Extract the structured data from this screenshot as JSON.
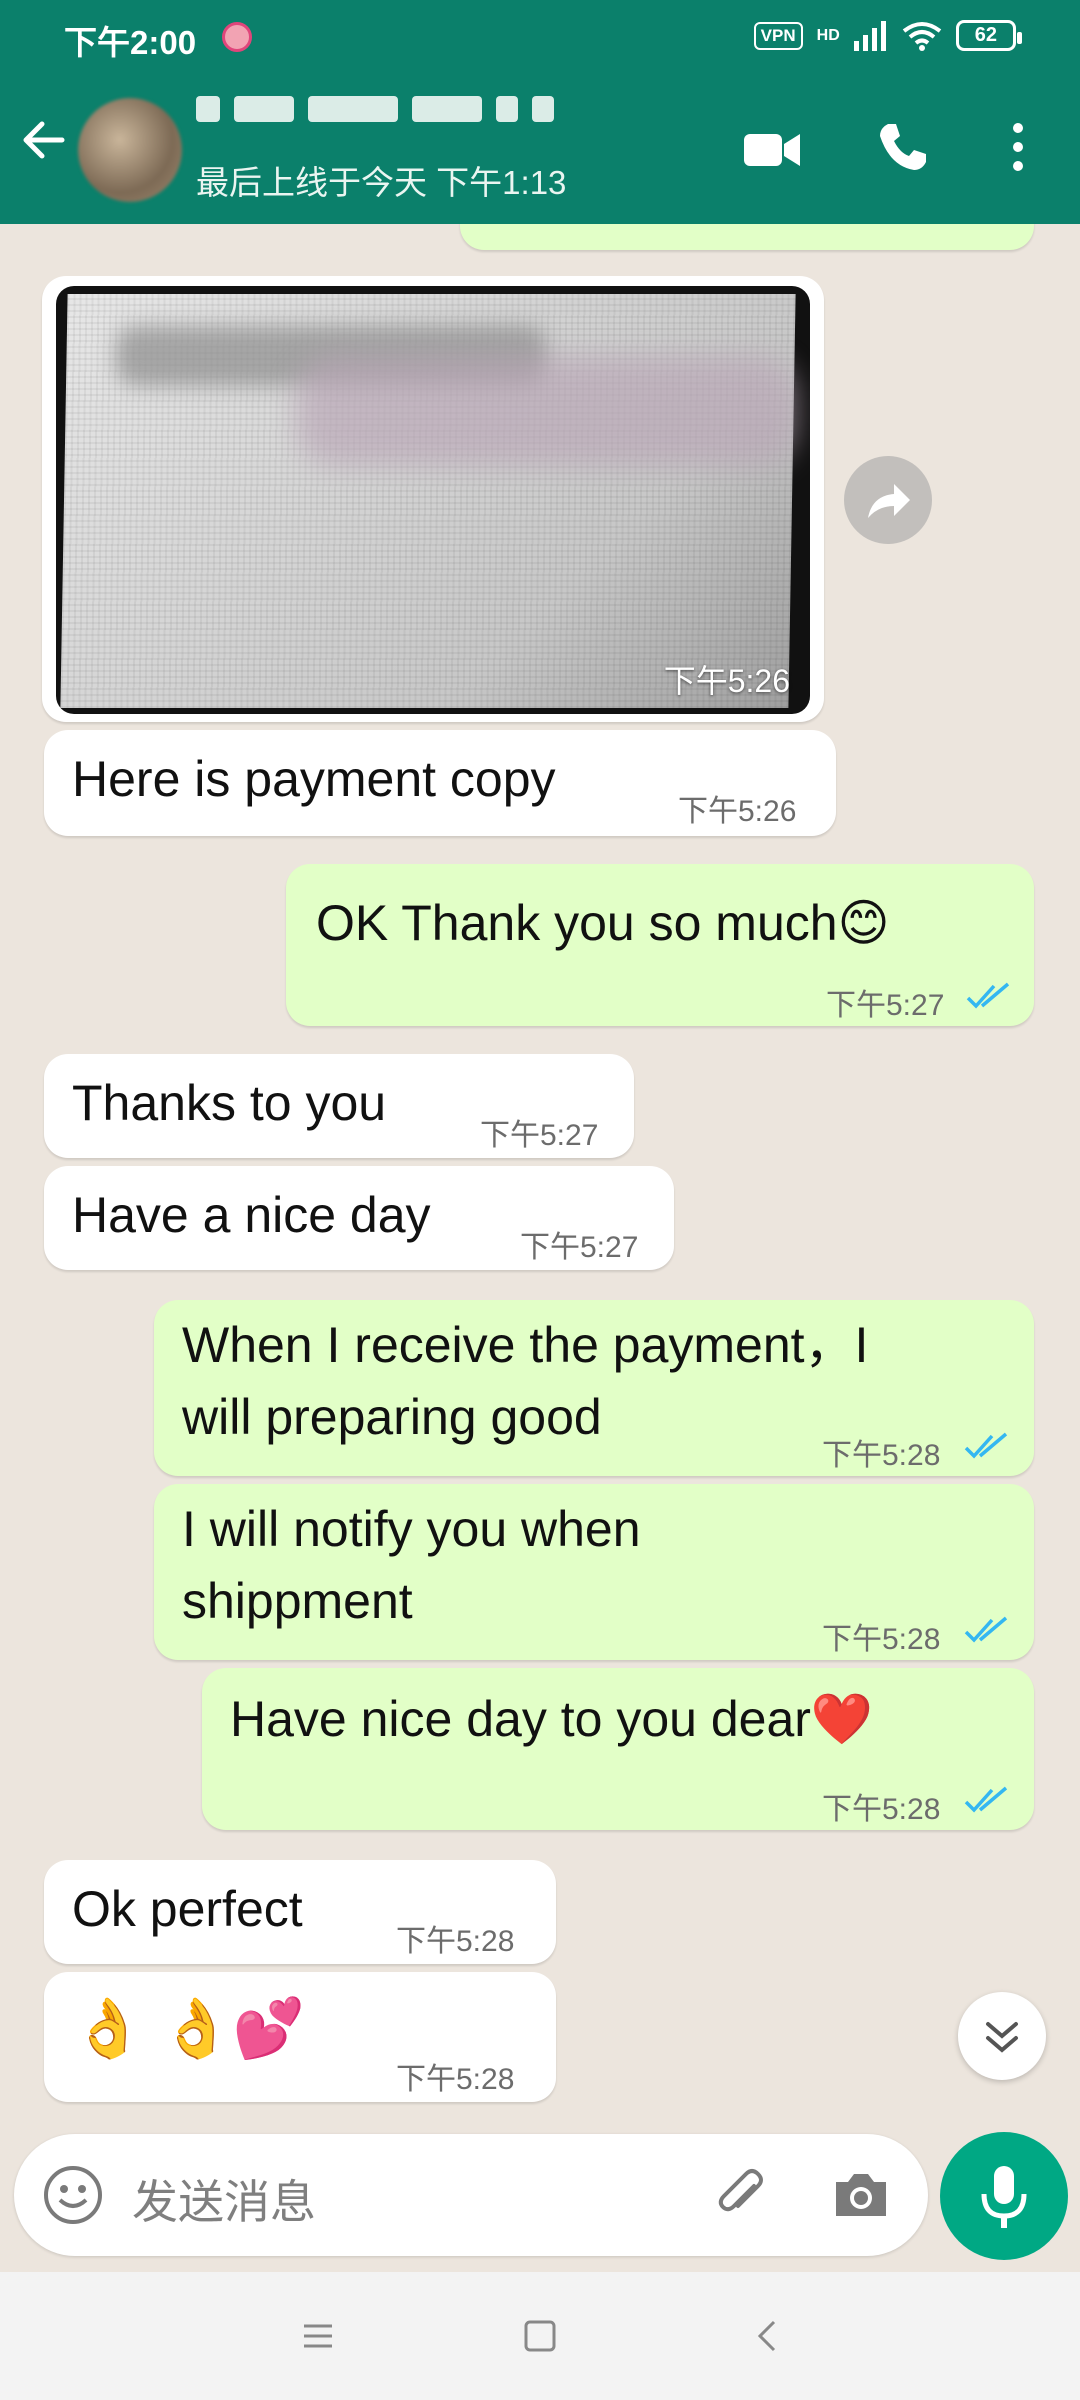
{
  "status_bar": {
    "time": "下午2:00",
    "vpn": "VPN",
    "hd": "HD",
    "battery": "62"
  },
  "header": {
    "last_seen": "最后上线于今天 下午1:13"
  },
  "messages": [
    {
      "id": "m1",
      "type": "image",
      "direction": "incoming",
      "time": "下午5:26"
    },
    {
      "id": "m2",
      "direction": "incoming",
      "text": "Here is payment copy",
      "time": "下午5:26"
    },
    {
      "id": "m3",
      "direction": "outgoing",
      "text": "OK Thank you so much😊",
      "time": "下午5:27"
    },
    {
      "id": "m4",
      "direction": "incoming",
      "text": "Thanks to you",
      "time": "下午5:27"
    },
    {
      "id": "m5",
      "direction": "incoming",
      "text": "Have a nice day",
      "time": "下午5:27"
    },
    {
      "id": "m6",
      "direction": "outgoing",
      "text_line1": "When I receive the payment，I",
      "text_line2": "will preparing good",
      "time": "下午5:28"
    },
    {
      "id": "m7",
      "direction": "outgoing",
      "text_line1": "I will notify you when",
      "text_line2": "shippment",
      "time": "下午5:28"
    },
    {
      "id": "m8",
      "direction": "outgoing",
      "text": "Have  nice day to you dear❤️",
      "time": "下午5:28"
    },
    {
      "id": "m9",
      "direction": "incoming",
      "text": "Ok perfect",
      "time": "下午5:28"
    },
    {
      "id": "m10",
      "direction": "incoming",
      "text": "👌 👌💕",
      "time": "下午5:28"
    }
  ],
  "composer": {
    "placeholder": "发送消息"
  },
  "colors": {
    "header": "#0b806b",
    "incoming_bubble": "#ffffff",
    "outgoing_bubble": "#e2ffc7",
    "chat_background": "#ece5dd",
    "read_ticks": "#34b7f1",
    "mic_button": "#00a884"
  },
  "icons": {
    "back": "arrow-left-icon",
    "video": "video-camera-icon",
    "call": "phone-icon",
    "menu": "more-vertical-icon",
    "emoji": "smiley-icon",
    "attach": "paperclip-icon",
    "camera": "camera-icon",
    "mic": "microphone-icon",
    "forward": "forward-arrow-icon",
    "scroll": "double-chevron-down-icon"
  }
}
